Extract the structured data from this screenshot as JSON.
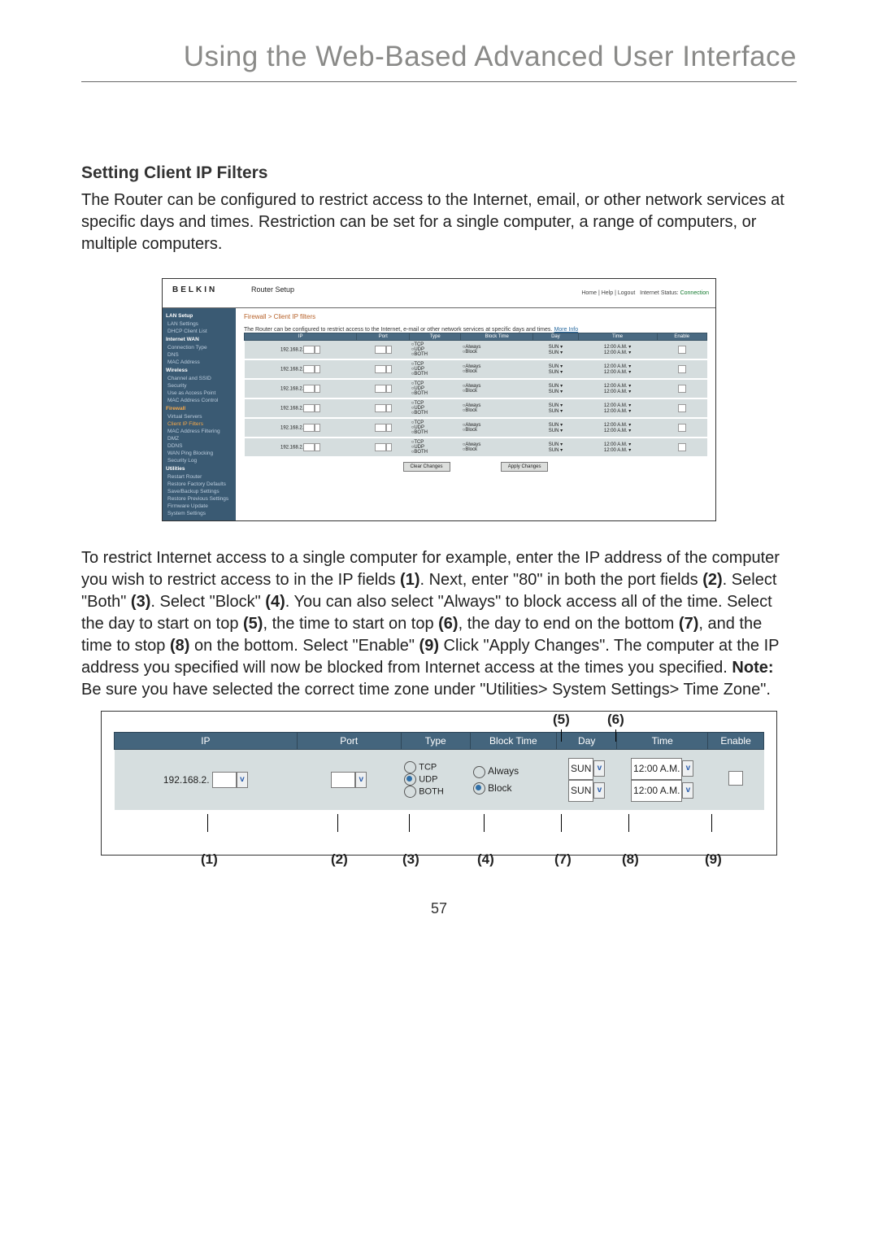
{
  "title": "Using the Web-Based Advanced User Interface",
  "section_heading": "Setting Client IP Filters",
  "intro_text": "The Router can be configured to restrict access to the Internet, email, or other network services at specific days and times. Restriction can be set for a single computer, a range of computers, or multiple computers.",
  "screenshot1": {
    "brand": "BELKIN",
    "heading": "Router Setup",
    "links": {
      "home": "Home",
      "help": "Help",
      "logout": "Logout",
      "status_label": "Internet Status:",
      "status_value": "Connection"
    },
    "sidebar": {
      "groups": [
        {
          "head": "LAN Setup",
          "items": [
            "LAN Settings",
            "DHCP Client List",
            "Internet WAN",
            "Connection Type",
            "DNS",
            "MAC Address"
          ]
        },
        {
          "head": "Wireless",
          "items": [
            "Channel and SSID",
            "Security",
            "Use as Access Point",
            "MAC Address Control"
          ]
        },
        {
          "head": "Firewall",
          "items": [
            "Virtual Servers",
            "Client IP Filters",
            "MAC Address Filtering",
            "DMZ",
            "DDNS",
            "WAN Ping Blocking",
            "Security Log"
          ]
        },
        {
          "head": "Utilities",
          "items": [
            "Restart Router",
            "Restore Factory Defaults",
            "Save/Backup Settings",
            "Restore Previous Settings",
            "Firmware Update",
            "System Settings"
          ]
        }
      ],
      "active": "Client IP Filters"
    },
    "breadcrumb": "Firewall > Client IP filters",
    "description": "The Router can be configured to restrict access to the Internet, e-mail or other network services at specific days and times.",
    "more_info": "More Info",
    "table": {
      "headers": [
        "IP",
        "Port",
        "Type",
        "Block Time",
        "Day",
        "Time",
        "Enable"
      ],
      "row_count": 6,
      "ip_prefix": "192.168.2.",
      "types": [
        "TCP",
        "UDP",
        "BOTH"
      ],
      "block_times": [
        "Always",
        "Block"
      ],
      "day_default": "SUN",
      "time_default": "12:00 A.M."
    },
    "buttons": {
      "clear": "Clear Changes",
      "apply": "Apply Changes"
    }
  },
  "body_para2_parts": [
    "To restrict Internet access to a single computer for example, enter the IP address of the computer you wish to restrict access to in the IP fields ",
    "(1)",
    ". Next, enter \"80\" in both the port fields ",
    "(2)",
    ". Select \"Both\" ",
    "(3)",
    ". Select \"Block\" ",
    "(4)",
    ". You can also select \"Always\" to block access all of the time. Select the day to start on top ",
    "(5)",
    ", the time to start on top ",
    "(6)",
    ", the day to end on the bottom ",
    "(7)",
    ", and the time to stop ",
    "(8)",
    " on the bottom. Select \"Enable\" ",
    "(9)",
    " Click \"Apply Changes\". The computer at the IP address you specified will now be blocked from Internet access at the times you specified. ",
    "Note:",
    " Be sure you have selected the correct time zone under \"Utilities> System Settings> Time Zone\"."
  ],
  "screenshot2": {
    "top_labels": {
      "n5": "(5)",
      "n6": "(6)"
    },
    "headers": [
      "IP",
      "Port",
      "Type",
      "Block Time",
      "Day",
      "Time",
      "Enable"
    ],
    "ip_prefix": "192.168.2.",
    "types": {
      "tcp": "TCP",
      "udp": "UDP",
      "both": "BOTH"
    },
    "block": {
      "always": "Always",
      "block": "Block"
    },
    "day": "SUN",
    "time": "12:00 A.M.",
    "bottom_labels": {
      "n1": "(1)",
      "n2": "(2)",
      "n3": "(3)",
      "n4": "(4)",
      "n7": "(7)",
      "n8": "(8)",
      "n9": "(9)"
    }
  },
  "page_number": "57"
}
